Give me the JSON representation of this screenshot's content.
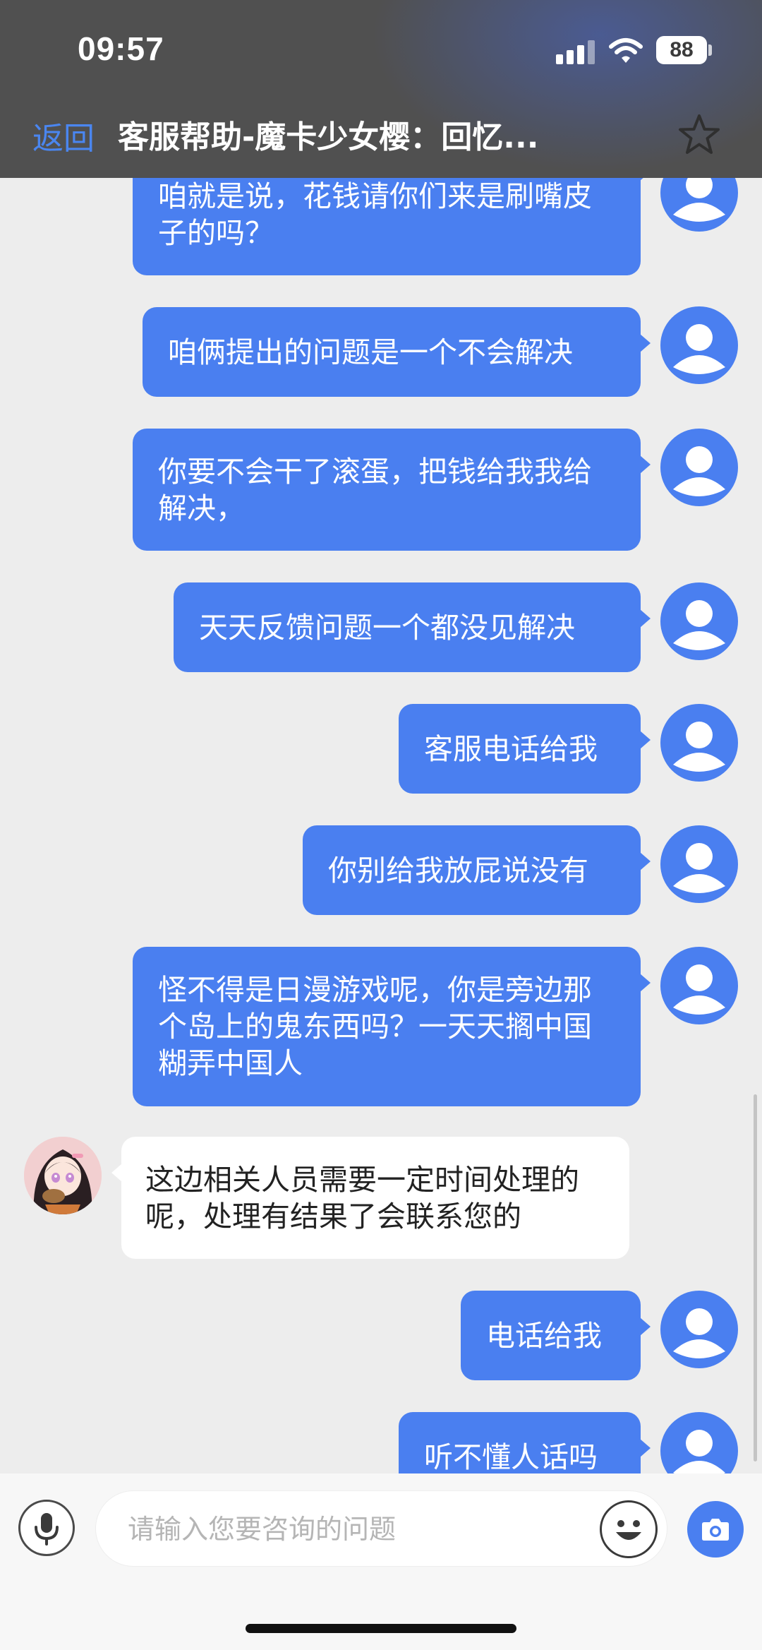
{
  "status_bar": {
    "time": "09:57",
    "battery": "88",
    "icons": [
      "cellular-signal-icon",
      "wifi-icon",
      "battery-icon"
    ]
  },
  "header": {
    "back_label": "返回",
    "title": "客服帮助-魔卡少女樱：回忆...",
    "star_icon": "star-outline-icon"
  },
  "messages": [
    {
      "from": "user",
      "text": "咱就是说，花钱请你们来是刷嘴皮子的吗？"
    },
    {
      "from": "user",
      "text": "咱俩提出的问题是一个不会解决"
    },
    {
      "from": "user",
      "text": "你要不会干了滚蛋，把钱给我我给解决，"
    },
    {
      "from": "user",
      "text": "天天反馈问题一个都没见解决"
    },
    {
      "from": "user",
      "text": "客服电话给我"
    },
    {
      "from": "user",
      "text": "你别给我放屁说没有"
    },
    {
      "from": "user",
      "text": "怪不得是日漫游戏呢，你是旁边那个岛上的鬼东西吗？一天天搁中国糊弄中国人"
    },
    {
      "from": "agent",
      "text": "这边相关人员需要一定时间处理的呢，处理有结果了会联系您的"
    },
    {
      "from": "user",
      "text": "电话给我"
    },
    {
      "from": "user",
      "text": "听不懂人话吗"
    }
  ],
  "input": {
    "placeholder": "请输入您要咨询的问题",
    "value": "",
    "icons": [
      "microphone-icon",
      "emoji-icon",
      "camera-icon"
    ]
  },
  "colors": {
    "accent": "#4a7ff0",
    "back_link": "#4a86f0",
    "header_bg": "#505050",
    "chat_bg": "#ededed"
  }
}
